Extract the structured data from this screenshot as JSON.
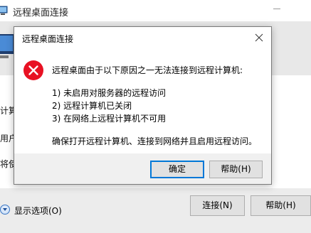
{
  "main_window": {
    "title": "远程桌面连接",
    "body_fragments": [
      "计算",
      "用户",
      "将使"
    ],
    "show_options_label": "显示选项(O)",
    "connect_label": "连接(N)",
    "help_label": "帮助(H)"
  },
  "dialog": {
    "title": "远程桌面连接",
    "message_heading": "远程桌面由于以下原因之一无法连接到远程计算机:",
    "reasons": [
      "1) 未启用对服务器的远程访问",
      "2) 远程计算机已关闭",
      "3) 在网络上远程计算机不可用"
    ],
    "footer_message": "确保打开远程计算机、连接到网络并且启用远程访问。",
    "ok_label": "确定",
    "help_label": "帮助(H)"
  },
  "colors": {
    "error_red": "#e81123",
    "focus_blue": "#0078d7"
  },
  "icons": {
    "app": "remote-desktop-icon",
    "error": "error-icon",
    "close": "close-icon",
    "options": "chevron-down-icon"
  }
}
